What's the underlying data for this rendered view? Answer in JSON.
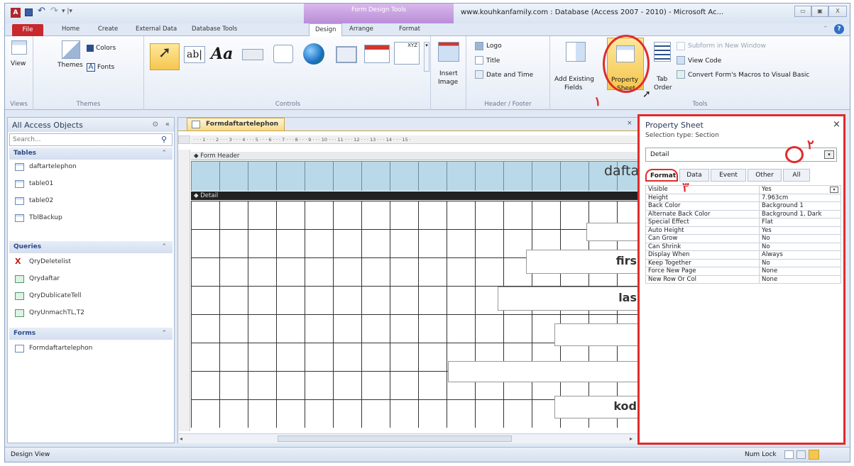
{
  "qat": {
    "app_icon": "access-icon",
    "save_icon": "save-icon",
    "undo_icon": "undo-icon",
    "redo_icon": "redo-icon"
  },
  "title": {
    "contextual_tab": "Form Design Tools",
    "window_title": "www.kouhkanfamily.com : Database (Access 2007 - 2010) - Microsoft Ac...",
    "min": "▭",
    "restore": "▣",
    "close": "X"
  },
  "tabs": {
    "file": "File",
    "home": "Home",
    "create": "Create",
    "external": "External Data",
    "dbtools": "Database Tools",
    "design": "Design",
    "arrange": "Arrange",
    "format": "Format"
  },
  "ribbon": {
    "views": {
      "view": "View",
      "group": "Views"
    },
    "themes": {
      "themes": "Themes",
      "colors": "Colors",
      "fonts": "Fonts",
      "group": "Themes"
    },
    "controls": {
      "group": "Controls"
    },
    "insert_image": {
      "line1": "Insert",
      "line2": "Image"
    },
    "header": {
      "logo": "Logo",
      "title": "Title",
      "datetime": "Date and Time",
      "group": "Header / Footer"
    },
    "tools": {
      "add_existing": "Add Existing",
      "fields": "Fields",
      "property": "Property",
      "sheet": "Sheet",
      "tab": "Tab",
      "order": "Order",
      "subform": "Subform in New Window",
      "view_code": "View Code",
      "convert": "Convert Form's Macros to Visual Basic",
      "group": "Tools"
    }
  },
  "nav": {
    "title": "All Access Objects",
    "search_placeholder": "Search...",
    "sections": [
      {
        "label": "Tables",
        "items": [
          "daftartelephon",
          "table01",
          "table02",
          "TblBackup"
        ]
      },
      {
        "label": "Queries",
        "items": [
          "QryDeletelist",
          "Qrydaftar",
          "QryDublicateTell",
          "QryUnmachTL,T2"
        ]
      },
      {
        "label": "Forms",
        "items": [
          "Formdaftartelephon"
        ]
      }
    ]
  },
  "doc": {
    "tab": "Formdaftartelephon",
    "ruler": "· · · 1 · · · 2 · · · 3 · · · 4 · · · 5 · · · 6 · · · 7 · · · 8 · · · 9 · · · 10 · · · 11 · · · 12 · · · 13 · · · 14 · · · 15 ·",
    "form_header": "Form Header",
    "detail": "Detail",
    "header_text": "dafta",
    "controls": [
      "firs",
      "las",
      "kod"
    ]
  },
  "props": {
    "title": "Property Sheet",
    "close": "×",
    "selection": "Selection type:  Section",
    "combo": "Detail",
    "tabs": [
      "Format",
      "Data",
      "Event",
      "Other",
      "All"
    ],
    "rows": [
      [
        "Visible",
        "Yes"
      ],
      [
        "Height",
        "7.963cm"
      ],
      [
        "Back Color",
        "Background 1"
      ],
      [
        "Alternate Back Color",
        "Background 1, Dark"
      ],
      [
        "Special Effect",
        "Flat"
      ],
      [
        "Auto Height",
        "Yes"
      ],
      [
        "Can Grow",
        "No"
      ],
      [
        "Can Shrink",
        "No"
      ],
      [
        "Display When",
        "Always"
      ],
      [
        "Keep Together",
        "No"
      ],
      [
        "Force New Page",
        "None"
      ],
      [
        "New Row Or Col",
        "None"
      ]
    ]
  },
  "annotations": {
    "one": "۱",
    "two": "۲",
    "three": "۳"
  },
  "status": {
    "left": "Design View",
    "numlock": "Num Lock"
  }
}
